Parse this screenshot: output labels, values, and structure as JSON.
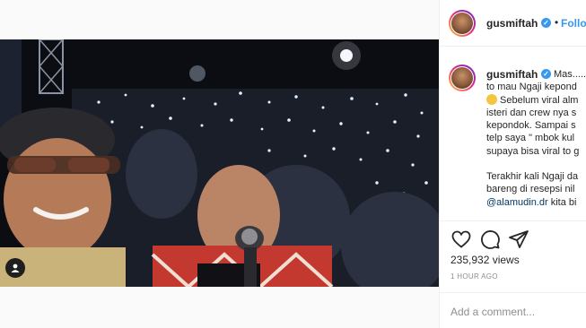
{
  "header": {
    "username": "gusmiftah",
    "follow_label": "Follow"
  },
  "caption": {
    "username": "gusmiftah",
    "lines": [
      "Mas......",
      "to mau Ngaji kepond",
      "Sebelum viral alm",
      "isteri dan crew nya s",
      "kepondok. Sampai s",
      "telp saya \" mbok kul",
      "supaya bisa viral to g"
    ],
    "lines2": [
      "Terakhir kali Ngaji da",
      "bareng di resepsi nil"
    ],
    "mention": "@alamudin.dr",
    "mention_tail": " kita bi"
  },
  "stats": {
    "views": "235,932 views",
    "time": "1 HOUR AGO"
  },
  "comment": {
    "placeholder": "Add a comment..."
  },
  "icons": {
    "like": "heart-icon",
    "comment": "comment-icon",
    "share": "share-icon",
    "tag": "user-tag-icon"
  },
  "colors": {
    "accent": "#3897f0",
    "text": "#262626",
    "muted": "#8e8e8e",
    "border": "#efefef"
  }
}
